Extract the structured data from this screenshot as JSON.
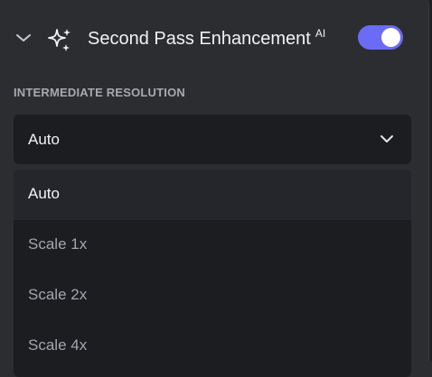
{
  "header": {
    "title": "Second Pass Enhancement",
    "badge": "AI",
    "toggle_state": "on",
    "collapse_icon": "chevron-down-icon",
    "feature_icon": "sparkles-icon"
  },
  "section": {
    "label": "INTERMEDIATE RESOLUTION"
  },
  "select": {
    "value": "Auto",
    "icon": "chevron-down-icon"
  },
  "dropdown": {
    "options": [
      {
        "label": "Auto",
        "selected": true
      },
      {
        "label": "Scale 1x",
        "selected": false
      },
      {
        "label": "Scale 2x",
        "selected": false
      },
      {
        "label": "Scale 4x",
        "selected": false
      }
    ]
  },
  "colors": {
    "panel_bg": "#2c2d31",
    "field_bg": "#1c1d21",
    "accent": "#6b6bf5",
    "label_muted": "#a7a9b0"
  }
}
